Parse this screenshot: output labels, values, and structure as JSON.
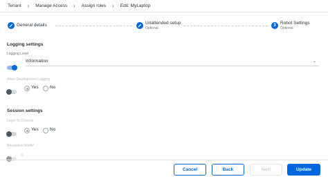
{
  "breadcrumb": [
    "Tenant",
    "Manage Access",
    "Assign roles",
    "Edit: MyLaptop"
  ],
  "stepper": {
    "steps": [
      {
        "label": "General details",
        "sub": "",
        "number": ""
      },
      {
        "label": "Unattended setup",
        "sub": "Optional",
        "number": ""
      },
      {
        "label": "Robot Settings",
        "sub": "Optional",
        "number": "3"
      }
    ]
  },
  "logging": {
    "title": "Logging settings",
    "level_label": "Logging Level",
    "level_value": "Information",
    "dev_label": "Allow Development Logging",
    "yes": "Yes",
    "no": "No"
  },
  "session": {
    "title": "Session settings",
    "login_label": "Login To Console",
    "yes": "Yes",
    "no": "No",
    "resolution_label": "Resolution Width*",
    "resolution_value": "0"
  },
  "footer": {
    "cancel": "Cancel",
    "back": "Back",
    "next": "Next",
    "update": "Update"
  },
  "colors": {
    "accent": "#0067df",
    "text": "#273139",
    "muted": "#6b7882"
  }
}
